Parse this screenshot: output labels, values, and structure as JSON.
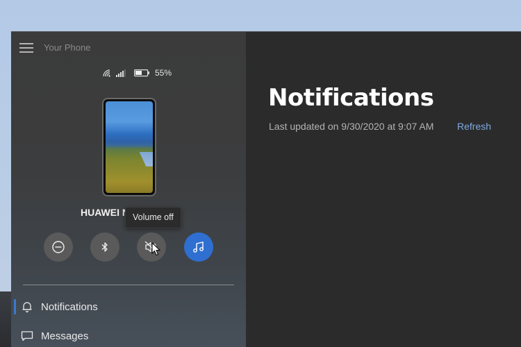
{
  "app": {
    "title": "Your Phone"
  },
  "status": {
    "wifi_icon": "wifi-icon",
    "signal_icon": "cellular-signal-icon",
    "battery_icon": "battery-icon",
    "battery_percent": "55%",
    "battery_level": 0.55
  },
  "device": {
    "name": "HUAWEI N",
    "wallpaper": "vineyard-lake-landscape"
  },
  "tooltip": {
    "text": "Volume off"
  },
  "quick_actions": [
    {
      "name": "do-not-disturb",
      "icon": "do-not-disturb-icon",
      "active": false
    },
    {
      "name": "bluetooth",
      "icon": "bluetooth-icon",
      "active": false
    },
    {
      "name": "volume-off",
      "icon": "volume-mute-icon",
      "active": false
    },
    {
      "name": "audio-player",
      "icon": "music-note-icon",
      "active": true
    }
  ],
  "nav": {
    "items": [
      {
        "label": "Notifications",
        "icon": "bell-icon",
        "selected": true
      },
      {
        "label": "Messages",
        "icon": "message-icon",
        "selected": false
      }
    ]
  },
  "main": {
    "title": "Notifications",
    "last_updated": "Last updated on 9/30/2020 at 9:07 AM",
    "refresh_label": "Refresh"
  },
  "colors": {
    "accent": "#2f6fd1",
    "link": "#7fa9e0",
    "selection_indicator": "#3c78d0"
  }
}
